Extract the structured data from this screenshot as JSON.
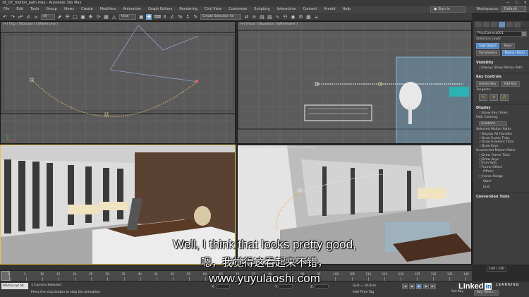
{
  "window": {
    "title": "16_07_motion_path.max - Autodesk 3ds Max",
    "buttons": [
      "—",
      "☐",
      "✕"
    ]
  },
  "menu": [
    "File",
    "Edit",
    "Tools",
    "Group",
    "Views",
    "Create",
    "Modifiers",
    "Animation",
    "Graph Editors",
    "Rendering",
    "Civil View",
    "Customize",
    "Scripting",
    "Interactive",
    "Content",
    "Arnold",
    "Help"
  ],
  "account": {
    "signin": "Sign In",
    "workspaces_label": "Workspaces:",
    "workspace": "Default"
  },
  "toolbar": {
    "filter": "All",
    "view": "View",
    "selection_set": "Create Selection Se"
  },
  "viewports": {
    "top": "[+] [Top ] [Standard ] [Wireframe ]",
    "front": "[+] [Front ] [Standard ] [Wireframe ]",
    "camera": "[+] [PhysCamera001 ] [Standard ] [Default Shading ]",
    "perspective": "[+] [Perspective ] [Standard ] [Default Shading ]"
  },
  "command_panel": {
    "object_name": "PhysCamera001",
    "selection_level_label": "Selection Level:",
    "sub_object": "Sub-Object",
    "key_dropdown": "Keys",
    "parameters": "Parameters",
    "motion_paths": "Motion Paths",
    "visibility_head": "Visibility",
    "always_show": "Always Show Motion Path",
    "key_controls_head": "Key Controls",
    "delete_key": "Delete Key",
    "add_key": "Add Key",
    "tangents": "Tangents:",
    "display_head": "Display",
    "show_key_times": "Show Key Times",
    "path_coloring": "Path Coloring:",
    "gradient": "Gradient",
    "selected_motion_paths": "Selected Motion Paths",
    "selected_options": [
      "Display All Handles",
      "Draw Frame Ticks",
      "Draw Gradient Ticks",
      "Draw Keys"
    ],
    "unselected_motion_paths": "Unselected Motion Paths",
    "unselected_options": [
      "Draw Frame Ticks",
      "Draw Keys"
    ],
    "trim_path": "Trim Path",
    "frame_offset": "Frame Offset",
    "offset_label": "Offset:",
    "frame_range": "Frame Range",
    "start_label": "Start:",
    "end_label": "End:",
    "conversion_head": "Conversion Tools"
  },
  "timeline": {
    "frame_counter": "140 / 140",
    "ticks": [
      "0",
      "5",
      "10",
      "15",
      "20",
      "25",
      "30",
      "35",
      "40",
      "45",
      "50",
      "55",
      "60",
      "65",
      "70",
      "75",
      "80",
      "85",
      "90",
      "95",
      "100",
      "105",
      "110",
      "115",
      "120",
      "125",
      "130",
      "135",
      "140"
    ]
  },
  "status": {
    "maxscript": "MAXScript Mi",
    "line1": "1 Camera Selected",
    "line2": "Press the stop button to stop the animation",
    "x_label": "X:",
    "y_label": "Y:",
    "z_label": "Z:",
    "grid": "Grid = 10.0cm",
    "add_time_tag": "Add Time Tag",
    "set_key": "Set Key",
    "key_filters": "Key Filters...",
    "play_controls": [
      "|◀",
      "◀|",
      "▶",
      "|▶",
      "▶|"
    ]
  },
  "branding": {
    "word": "Linked",
    "in": "in",
    "learning": "LEARNING"
  },
  "subtitles": {
    "en": "Well, I think that looks pretty good,",
    "zh": "嗯，我觉得这看起来不错，",
    "url": "www.yuyulaoshi.com"
  }
}
